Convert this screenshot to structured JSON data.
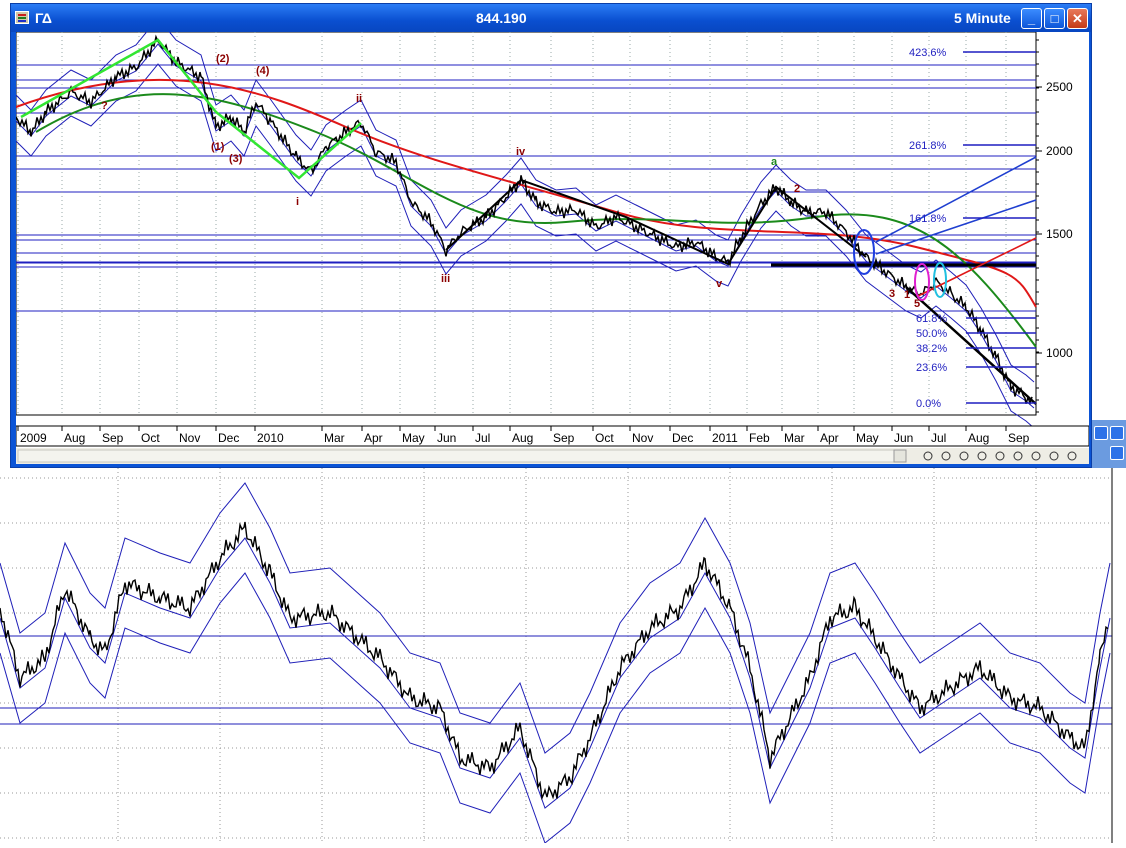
{
  "window": {
    "title_left": "ΓΔ",
    "title_center": "844.190",
    "title_right": "5 Minute",
    "buttons": {
      "minimize": "_",
      "maximize": "□",
      "close": "✕"
    }
  },
  "price_axis": {
    "labels": [
      {
        "text": "2500",
        "value": 2500
      },
      {
        "text": "2000",
        "value": 2000
      },
      {
        "text": "1500",
        "value": 1500
      },
      {
        "text": "1000",
        "value": 1000
      }
    ]
  },
  "fib_levels": [
    {
      "text": "423.6%"
    },
    {
      "text": "261.8%"
    },
    {
      "text": "161.8%"
    },
    {
      "text": "61.8%"
    },
    {
      "text": "50.0%"
    },
    {
      "text": "38.2%"
    },
    {
      "text": "23.6%"
    },
    {
      "text": "0.0%"
    }
  ],
  "time_axis": [
    "2009",
    "Aug",
    "Sep",
    "Oct",
    "Nov",
    "Dec",
    "2010",
    "Mar",
    "Apr",
    "May",
    "Jun",
    "Jul",
    "Aug",
    "Sep",
    "Oct",
    "Nov",
    "Dec",
    "2011",
    "Feb",
    "Mar",
    "Apr",
    "May",
    "Jun",
    "Jul",
    "Aug",
    "Sep"
  ],
  "wave_labels": [
    {
      "text": "?",
      "color": "#8b0000"
    },
    {
      "text": "(1)",
      "color": "#8b0000"
    },
    {
      "text": "(2)",
      "color": "#8b0000"
    },
    {
      "text": "(3)",
      "color": "#8b0000"
    },
    {
      "text": "(4)",
      "color": "#8b0000"
    },
    {
      "text": "ii",
      "color": "#8b0000"
    },
    {
      "text": "i",
      "color": "#8b0000"
    },
    {
      "text": "iii",
      "color": "#8b0000"
    },
    {
      "text": "iv",
      "color": "#8b0000"
    },
    {
      "text": "v",
      "color": "#8b0000"
    },
    {
      "text": "a",
      "color": "#1e8a1e"
    },
    {
      "text": "1",
      "color": "#8b0000"
    },
    {
      "text": "2",
      "color": "#8b0000"
    },
    {
      "text": "3",
      "color": "#8b0000"
    },
    {
      "text": "5",
      "color": "#8b0000"
    }
  ],
  "colors": {
    "price": "#000000",
    "bands": "#1f1fb8",
    "hlines": "#1f1fc0",
    "ma_red": "#e01818",
    "ma_green": "#1b8a1b",
    "wave_green": "#32e632",
    "wave_black": "#000000",
    "label_red": "#8b0000",
    "window_blue": "#0b54d6"
  },
  "toolbar_icons": [
    "refresh-icon",
    "cursor-icon",
    "crosshair-icon",
    "zoom-in-icon",
    "zoom-out-icon",
    "circle-icon",
    "arrow-left-icon",
    "arrow-right-icon",
    "menu-icon"
  ]
}
